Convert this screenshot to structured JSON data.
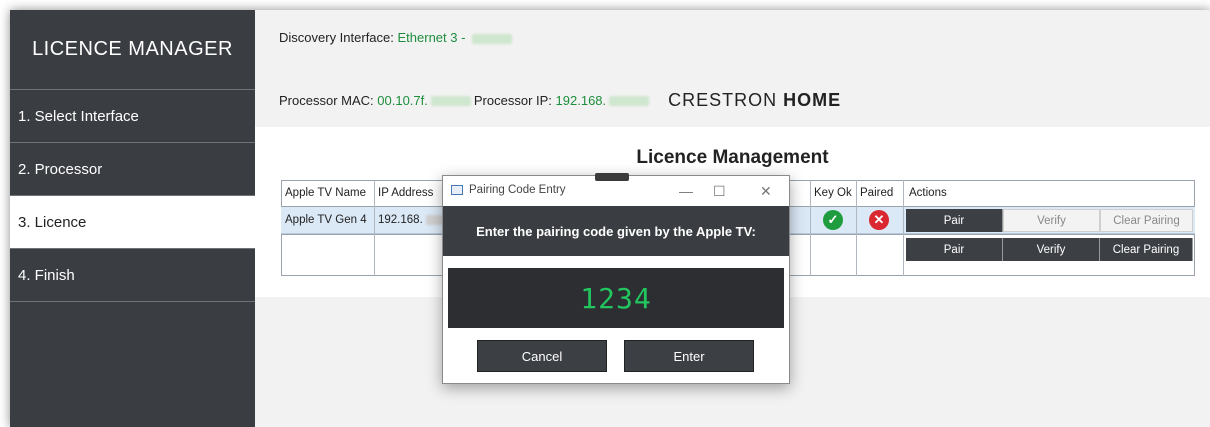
{
  "sidebar": {
    "title": "LICENCE MANAGER",
    "items": [
      {
        "label": "1. Select Interface"
      },
      {
        "label": "2. Processor"
      },
      {
        "label": "3. Licence"
      },
      {
        "label": "4. Finish"
      }
    ]
  },
  "header": {
    "discovery_label": "Discovery Interface:",
    "discovery_value": "Ethernet 3 -",
    "mac_label": "Processor MAC:",
    "mac_value": "00.10.7f.",
    "ip_label": "Processor IP:",
    "ip_value": "192.168.",
    "brand_light": "CRESTRON",
    "brand_bold": "HOME"
  },
  "licence": {
    "title": "Licence Management",
    "columns": [
      "Apple TV Name",
      "IP Address",
      "Key Ok",
      "Paired",
      "Actions"
    ],
    "rows": [
      {
        "name": "Apple TV Gen 4",
        "ip": "192.168.",
        "key_ok": "ok",
        "paired": "no"
      },
      {
        "name": "",
        "ip": ""
      }
    ],
    "actions": {
      "pair": "Pair",
      "verify": "Verify",
      "clear": "Clear Pairing"
    }
  },
  "dialog": {
    "title": "Pairing Code Entry",
    "prompt": "Enter the pairing code given by the Apple TV:",
    "code": "1234",
    "cancel": "Cancel",
    "enter": "Enter"
  },
  "colors": {
    "sidebar": "#3a3d42",
    "code_text": "#22c55e",
    "ok": "#1f9d3e",
    "error": "#d9282f"
  }
}
